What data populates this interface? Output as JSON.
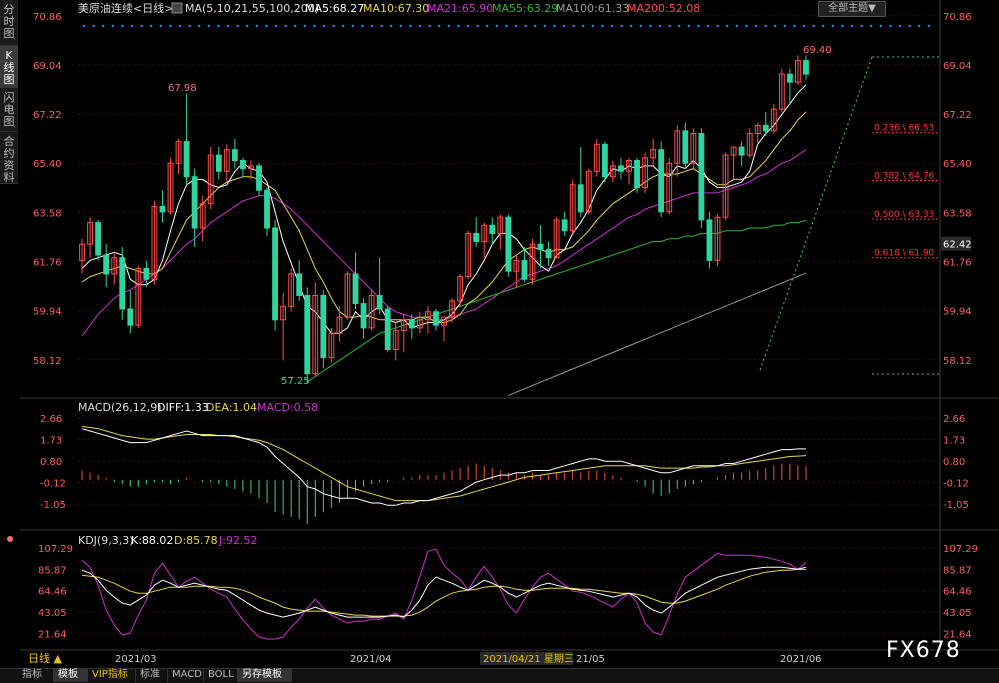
{
  "sidebar": {
    "tabs": [
      "分时图",
      "K线图",
      "闪电图",
      "合约资料"
    ],
    "active": 1
  },
  "header": {
    "symbol": "美原油连续<日线>",
    "ma_label": "MA(5,10,21,55,100,200)",
    "ma5": "MA5:68.27",
    "ma10": "MA10:67.30",
    "ma21": "MA21:65.90",
    "ma55": "MA55:63.29",
    "ma100": "MA100:61.33",
    "ma200": "MA200:52.08",
    "theme_button": "全部主题▼"
  },
  "colors": {
    "up": "#ff4d4d",
    "down": "#2fd4a0",
    "ma5": "#ffffff",
    "ma10": "#e6d84a",
    "ma21": "#d02fd0",
    "ma55": "#2eb82e",
    "ma100": "#9a9a9a",
    "fib": "#ff3333",
    "dotted": "#1e8fff",
    "grid": "#3a0a0a"
  },
  "main_axis": {
    "ticks": [
      "70.86",
      "69.04",
      "67.22",
      "65.40",
      "63.58",
      "61.76",
      "59.94",
      "58.12"
    ],
    "current_price": "62.42"
  },
  "annotations": {
    "high_label": "67.98",
    "low_label": "57.25",
    "recent_high_label": "69.40"
  },
  "fib_levels": [
    "0.236 \\ 66.53",
    "0.382 \\ 64.76",
    "0.500 \\ 63.33",
    "0.618 \\ 61.90"
  ],
  "macd": {
    "title": "MACD(26,12,9)",
    "diff": "DIFF:1.33",
    "dea": "DEA:1.04",
    "macd": "MACD:0.58",
    "ticks": [
      "2.66",
      "1.73",
      "0.80",
      "-0.12",
      "-1.05"
    ]
  },
  "kdj": {
    "title": "KDJ(9,3,3)",
    "k": "K:88.02",
    "d": "D:85.78",
    "j": "J:92.52",
    "ticks": [
      "107.29",
      "85.87",
      "64.46",
      "43.05",
      "21.64"
    ]
  },
  "time_axis": {
    "labels": [
      "2021/03",
      "2021/04",
      "2021/04/21 星期三",
      "21/05",
      "2021/06"
    ],
    "period": "日线 ▲"
  },
  "bottom_tabs": [
    "指标",
    "模板",
    "VIP指标",
    "标准",
    "MACD",
    "BOLL",
    "另存模板"
  ],
  "watermark": "FX678",
  "chart_data": {
    "type": "candlestick",
    "ylim": [
      57.0,
      71.0
    ],
    "candles": [
      [
        61.8,
        62.6,
        61.3,
        62.4
      ],
      [
        62.4,
        63.4,
        61.9,
        63.2
      ],
      [
        63.2,
        63.3,
        61.8,
        62.0
      ],
      [
        62.0,
        62.4,
        60.8,
        61.3
      ],
      [
        61.3,
        62.1,
        60.9,
        61.9
      ],
      [
        61.9,
        62.3,
        59.6,
        60.0
      ],
      [
        60.0,
        60.7,
        59.1,
        59.4
      ],
      [
        59.4,
        61.6,
        59.3,
        61.5
      ],
      [
        61.5,
        61.8,
        60.8,
        61.1
      ],
      [
        61.1,
        64.0,
        60.9,
        63.8
      ],
      [
        63.8,
        64.4,
        63.2,
        63.6
      ],
      [
        63.6,
        65.6,
        63.5,
        65.4
      ],
      [
        65.4,
        66.3,
        65.0,
        66.2
      ],
      [
        66.2,
        67.98,
        64.6,
        64.9
      ],
      [
        64.9,
        65.2,
        62.3,
        63.0
      ],
      [
        63.0,
        64.2,
        62.5,
        63.9
      ],
      [
        63.9,
        66.0,
        63.7,
        65.7
      ],
      [
        65.7,
        66.0,
        64.8,
        65.1
      ],
      [
        65.1,
        66.1,
        64.7,
        65.9
      ],
      [
        65.9,
        66.3,
        65.2,
        65.5
      ],
      [
        65.5,
        65.6,
        64.9,
        65.2
      ],
      [
        65.2,
        65.5,
        64.8,
        65.3
      ],
      [
        65.3,
        65.4,
        64.2,
        64.4
      ],
      [
        64.4,
        64.5,
        62.7,
        63.0
      ],
      [
        63.0,
        63.3,
        59.2,
        59.6
      ],
      [
        59.6,
        60.6,
        58.1,
        60.1
      ],
      [
        60.1,
        61.5,
        59.9,
        61.3
      ],
      [
        61.3,
        61.8,
        60.3,
        60.5
      ],
      [
        60.5,
        60.8,
        57.25,
        57.6
      ],
      [
        57.6,
        61.0,
        57.5,
        60.5
      ],
      [
        60.5,
        60.7,
        57.8,
        58.2
      ],
      [
        58.2,
        59.3,
        58.0,
        59.1
      ],
      [
        59.1,
        60.1,
        58.8,
        59.7
      ],
      [
        59.7,
        61.4,
        59.6,
        61.3
      ],
      [
        61.3,
        62.1,
        60.0,
        60.2
      ],
      [
        60.2,
        60.4,
        58.9,
        59.3
      ],
      [
        59.3,
        60.7,
        59.2,
        60.5
      ],
      [
        60.5,
        61.9,
        59.8,
        60.0
      ],
      [
        60.0,
        60.1,
        58.4,
        58.5
      ],
      [
        58.5,
        59.5,
        58.1,
        59.2
      ],
      [
        59.2,
        59.8,
        58.4,
        59.6
      ],
      [
        59.6,
        59.8,
        58.9,
        59.3
      ],
      [
        59.3,
        59.9,
        59.1,
        59.6
      ],
      [
        59.6,
        60.1,
        59.1,
        59.9
      ],
      [
        59.9,
        60.0,
        59.2,
        59.4
      ],
      [
        59.4,
        59.6,
        58.8,
        59.7
      ],
      [
        59.7,
        60.4,
        59.5,
        60.3
      ],
      [
        60.3,
        61.3,
        60.1,
        61.2
      ],
      [
        61.2,
        62.9,
        61.1,
        62.8
      ],
      [
        62.8,
        63.4,
        62.3,
        62.5
      ],
      [
        62.5,
        63.2,
        61.9,
        63.1
      ],
      [
        63.1,
        63.4,
        62.4,
        62.8
      ],
      [
        62.8,
        63.5,
        62.2,
        63.4
      ],
      [
        63.4,
        63.5,
        61.2,
        61.4
      ],
      [
        61.4,
        62.0,
        60.8,
        61.8
      ],
      [
        61.8,
        62.3,
        61.0,
        61.1
      ],
      [
        61.1,
        62.6,
        60.9,
        62.4
      ],
      [
        62.4,
        63.1,
        61.5,
        62.2
      ],
      [
        62.2,
        62.5,
        61.6,
        61.9
      ],
      [
        61.9,
        63.4,
        61.9,
        63.3
      ],
      [
        63.3,
        63.6,
        62.7,
        62.9
      ],
      [
        62.9,
        64.8,
        62.8,
        64.6
      ],
      [
        64.6,
        66.0,
        63.4,
        63.6
      ],
      [
        63.6,
        65.2,
        63.5,
        65.1
      ],
      [
        65.1,
        66.3,
        64.9,
        66.1
      ],
      [
        66.1,
        66.2,
        64.7,
        64.9
      ],
      [
        64.9,
        65.5,
        64.7,
        65.3
      ],
      [
        65.3,
        65.6,
        64.8,
        65.1
      ],
      [
        65.1,
        65.6,
        64.6,
        65.5
      ],
      [
        65.5,
        65.6,
        64.3,
        64.5
      ],
      [
        64.5,
        65.8,
        64.3,
        65.6
      ],
      [
        65.6,
        66.3,
        65.3,
        65.9
      ],
      [
        65.9,
        66.2,
        63.4,
        63.6
      ],
      [
        63.6,
        65.6,
        63.5,
        65.4
      ],
      [
        65.4,
        66.8,
        64.9,
        66.6
      ],
      [
        66.6,
        66.9,
        65.2,
        65.4
      ],
      [
        65.4,
        66.7,
        65.2,
        66.5
      ],
      [
        66.5,
        66.7,
        63.0,
        63.3
      ],
      [
        63.3,
        63.6,
        61.5,
        61.8
      ],
      [
        61.8,
        63.5,
        61.6,
        63.4
      ],
      [
        63.4,
        65.8,
        63.3,
        65.7
      ],
      [
        65.7,
        66.0,
        64.8,
        66.0
      ],
      [
        66.0,
        66.2,
        65.3,
        65.7
      ],
      [
        65.7,
        66.7,
        65.6,
        66.5
      ],
      [
        66.5,
        66.9,
        66.1,
        66.8
      ],
      [
        66.8,
        67.3,
        66.4,
        66.6
      ],
      [
        66.6,
        67.6,
        66.5,
        67.4
      ],
      [
        67.4,
        68.9,
        67.3,
        68.7
      ],
      [
        68.7,
        68.9,
        67.6,
        68.4
      ],
      [
        68.4,
        69.4,
        68.3,
        69.2
      ],
      [
        69.2,
        69.4,
        68.5,
        68.7
      ]
    ],
    "ma5_values": [
      61.5,
      61.8,
      61.9,
      62.0,
      62.1,
      62.0,
      61.1,
      60.9,
      60.9,
      61.1,
      61.8,
      62.9,
      63.9,
      64.6,
      64.8,
      64.8,
      64.6,
      64.5,
      64.6,
      65.1,
      65.4,
      65.2,
      65.1,
      64.7,
      63.6,
      62.5,
      61.7,
      60.9,
      60.1,
      59.9,
      59.5,
      59.1,
      59.1,
      59.3,
      59.9,
      59.6,
      59.9,
      60.1,
      59.6,
      59.5,
      59.6,
      59.3,
      59.4,
      59.5,
      59.5,
      59.6,
      59.8,
      60.2,
      60.9,
      61.3,
      61.8,
      62.4,
      62.8,
      62.8,
      62.6,
      62.2,
      61.9,
      61.6,
      61.4,
      62.0,
      62.2,
      62.8,
      63.2,
      63.7,
      64.4,
      64.8,
      65.2,
      65.1,
      65.3,
      65.2,
      65.3,
      65.3,
      65.0,
      64.9,
      65.3,
      65.2,
      65.5,
      65.2,
      64.7,
      64.5,
      64.5,
      64.6,
      64.7,
      65.1,
      66.1,
      66.5,
      66.8,
      67.2,
      67.6,
      68.0,
      68.3
    ],
    "ma10_values": [
      61.0,
      61.2,
      61.3,
      61.4,
      61.5,
      61.6,
      61.5,
      61.4,
      61.3,
      61.3,
      61.5,
      62.1,
      62.7,
      63.3,
      63.6,
      63.9,
      64.2,
      64.5,
      64.7,
      64.8,
      64.9,
      64.9,
      64.8,
      64.6,
      64.4,
      63.9,
      63.4,
      62.9,
      62.2,
      61.5,
      61.0,
      60.4,
      59.9,
      59.7,
      59.7,
      59.8,
      59.7,
      59.6,
      59.6,
      59.6,
      59.6,
      59.6,
      59.7,
      59.7,
      59.5,
      59.5,
      59.6,
      59.8,
      60.2,
      60.4,
      60.7,
      61.0,
      61.4,
      61.8,
      62.0,
      62.2,
      62.3,
      62.2,
      62.1,
      62.2,
      62.2,
      62.3,
      62.6,
      62.9,
      63.3,
      63.6,
      63.9,
      64.1,
      64.3,
      64.5,
      64.7,
      64.9,
      65.0,
      65.0,
      65.0,
      65.1,
      65.2,
      65.0,
      64.8,
      64.6,
      64.6,
      64.8,
      64.8,
      64.9,
      65.2,
      65.5,
      65.9,
      66.3,
      66.6,
      67.0,
      67.3
    ],
    "ma21_values": [
      59.0,
      59.4,
      59.8,
      60.1,
      60.4,
      60.6,
      60.7,
      60.9,
      61.1,
      61.3,
      61.5,
      61.8,
      62.1,
      62.4,
      62.6,
      62.9,
      63.2,
      63.4,
      63.6,
      63.8,
      64.0,
      64.1,
      64.2,
      64.2,
      64.1,
      63.9,
      63.7,
      63.4,
      63.1,
      62.8,
      62.5,
      62.2,
      61.9,
      61.6,
      61.3,
      61.0,
      60.7,
      60.4,
      60.1,
      59.9,
      59.8,
      59.7,
      59.7,
      59.6,
      59.6,
      59.6,
      59.7,
      59.8,
      59.9,
      60.0,
      60.2,
      60.4,
      60.6,
      60.8,
      61.0,
      61.2,
      61.3,
      61.4,
      61.5,
      61.6,
      61.8,
      62.0,
      62.2,
      62.4,
      62.6,
      62.8,
      63.0,
      63.2,
      63.4,
      63.5,
      63.7,
      63.8,
      63.9,
      64.0,
      64.1,
      64.2,
      64.3,
      64.3,
      64.3,
      64.3,
      64.4,
      64.5,
      64.6,
      64.7,
      64.9,
      65.0,
      65.2,
      65.4,
      65.5,
      65.7,
      65.9
    ],
    "ma55_values": [
      null,
      null,
      null,
      null,
      null,
      null,
      null,
      null,
      null,
      null,
      null,
      null,
      null,
      null,
      null,
      null,
      null,
      null,
      null,
      null,
      null,
      null,
      null,
      null,
      null,
      null,
      null,
      null,
      57.3,
      57.5,
      57.7,
      57.9,
      58.1,
      58.3,
      58.5,
      58.7,
      58.9,
      59.1,
      59.2,
      59.3,
      59.4,
      59.5,
      59.6,
      59.7,
      59.8,
      59.9,
      60.0,
      60.1,
      60.2,
      60.3,
      60.4,
      60.5,
      60.6,
      60.7,
      60.8,
      60.9,
      61.0,
      61.1,
      61.2,
      61.3,
      61.4,
      61.5,
      61.6,
      61.7,
      61.8,
      61.9,
      62.0,
      62.1,
      62.2,
      62.3,
      62.4,
      62.5,
      62.5,
      62.6,
      62.6,
      62.7,
      62.7,
      62.8,
      62.8,
      62.8,
      62.9,
      62.9,
      62.9,
      63.0,
      63.0,
      63.0,
      63.1,
      63.1,
      63.2,
      63.2,
      63.29
    ],
    "ma100_line": {
      "start_index": 53,
      "start_value": 56.8,
      "end_index": 90,
      "end_value": 61.33
    },
    "macd_hist": [
      0.4,
      0.3,
      0.2,
      0.1,
      -0.1,
      -0.2,
      -0.3,
      -0.3,
      -0.2,
      -0.1,
      -0.1,
      -0.2,
      -0.1,
      0.1,
      0.0,
      -0.1,
      -0.1,
      -0.2,
      -0.3,
      -0.4,
      -0.5,
      -0.6,
      -0.8,
      -1.0,
      -1.4,
      -1.5,
      -1.6,
      -1.7,
      -1.9,
      -1.6,
      -1.4,
      -1.2,
      -1.0,
      -0.8,
      -0.5,
      -0.3,
      -0.2,
      -0.1,
      -0.1,
      0.0,
      0.1,
      0.1,
      0.2,
      0.2,
      0.2,
      0.3,
      0.4,
      0.5,
      0.6,
      0.7,
      0.6,
      0.5,
      0.4,
      0.3,
      0.3,
      0.2,
      0.3,
      0.2,
      0.2,
      0.3,
      0.3,
      0.4,
      0.3,
      0.4,
      0.4,
      0.3,
      0.2,
      0.1,
      0.0,
      -0.1,
      -0.3,
      -0.6,
      -0.7,
      -0.6,
      -0.4,
      -0.3,
      -0.2,
      -0.1,
      0.0,
      0.1,
      0.2,
      0.3,
      0.3,
      0.4,
      0.4,
      0.5,
      0.6,
      0.7,
      0.7,
      0.6,
      0.58
    ],
    "macd_diff": [
      2.2,
      2.1,
      2.0,
      1.9,
      1.8,
      1.7,
      1.6,
      1.6,
      1.6,
      1.7,
      1.8,
      1.9,
      2.0,
      2.1,
      2.0,
      1.9,
      1.9,
      1.9,
      1.9,
      1.9,
      1.8,
      1.7,
      1.6,
      1.4,
      1.0,
      0.7,
      0.4,
      0.1,
      -0.3,
      -0.4,
      -0.6,
      -0.7,
      -0.8,
      -0.8,
      -0.8,
      -0.9,
      -1.0,
      -1.0,
      -1.1,
      -1.1,
      -1.0,
      -1.0,
      -0.9,
      -0.9,
      -0.8,
      -0.7,
      -0.6,
      -0.5,
      -0.3,
      -0.1,
      0.0,
      0.1,
      0.2,
      0.2,
      0.3,
      0.3,
      0.4,
      0.4,
      0.4,
      0.5,
      0.6,
      0.7,
      0.8,
      0.9,
      0.9,
      0.8,
      0.8,
      0.8,
      0.7,
      0.6,
      0.5,
      0.4,
      0.3,
      0.3,
      0.4,
      0.5,
      0.6,
      0.6,
      0.6,
      0.6,
      0.7,
      0.7,
      0.8,
      0.9,
      1.0,
      1.1,
      1.2,
      1.3,
      1.3,
      1.33,
      1.33
    ],
    "macd_dea": [
      2.3,
      2.25,
      2.2,
      2.1,
      2.0,
      1.9,
      1.85,
      1.8,
      1.75,
      1.75,
      1.8,
      1.85,
      1.9,
      1.95,
      1.95,
      1.95,
      1.95,
      1.9,
      1.9,
      1.85,
      1.8,
      1.75,
      1.7,
      1.6,
      1.45,
      1.3,
      1.1,
      0.9,
      0.7,
      0.5,
      0.3,
      0.1,
      -0.1,
      -0.3,
      -0.4,
      -0.5,
      -0.6,
      -0.7,
      -0.8,
      -0.9,
      -0.9,
      -0.9,
      -0.9,
      -0.9,
      -0.85,
      -0.8,
      -0.75,
      -0.7,
      -0.6,
      -0.5,
      -0.4,
      -0.3,
      -0.2,
      -0.1,
      0.0,
      0.1,
      0.15,
      0.2,
      0.25,
      0.3,
      0.35,
      0.4,
      0.45,
      0.5,
      0.55,
      0.6,
      0.6,
      0.6,
      0.6,
      0.6,
      0.6,
      0.55,
      0.5,
      0.5,
      0.5,
      0.5,
      0.5,
      0.55,
      0.55,
      0.6,
      0.6,
      0.65,
      0.7,
      0.75,
      0.8,
      0.85,
      0.9,
      0.95,
      1.0,
      1.02,
      1.04
    ],
    "kdj_k": [
      85,
      82,
      75,
      65,
      58,
      52,
      50,
      55,
      60,
      70,
      75,
      72,
      68,
      70,
      72,
      70,
      68,
      66,
      65,
      60,
      55,
      50,
      45,
      42,
      40,
      38,
      40,
      42,
      45,
      48,
      45,
      42,
      40,
      38,
      38,
      38,
      38,
      38,
      39,
      40,
      38,
      45,
      55,
      70,
      78,
      75,
      72,
      68,
      65,
      70,
      75,
      72,
      68,
      62,
      58,
      62,
      66,
      70,
      72,
      70,
      68,
      66,
      65,
      64,
      62,
      60,
      58,
      60,
      62,
      58,
      50,
      45,
      42,
      48,
      55,
      62,
      66,
      70,
      74,
      78,
      80,
      82,
      84,
      86,
      87,
      88,
      88,
      88,
      87,
      86,
      88
    ],
    "kdj_d": [
      80,
      79,
      78,
      75,
      72,
      68,
      64,
      62,
      62,
      64,
      66,
      68,
      68,
      68,
      69,
      69,
      69,
      68,
      68,
      67,
      65,
      62,
      58,
      55,
      52,
      48,
      46,
      45,
      44,
      44,
      44,
      43,
      42,
      41,
      40,
      40,
      39,
      39,
      39,
      39,
      39,
      40,
      43,
      48,
      54,
      58,
      62,
      64,
      65,
      66,
      68,
      69,
      69,
      68,
      66,
      65,
      65,
      66,
      67,
      67,
      67,
      67,
      66,
      66,
      65,
      64,
      63,
      62,
      62,
      61,
      59,
      56,
      53,
      52,
      52,
      54,
      57,
      60,
      63,
      66,
      70,
      73,
      76,
      79,
      81,
      83,
      84,
      85,
      85,
      86,
      85.78
    ],
    "kdj_j": [
      95,
      88,
      70,
      45,
      30,
      20,
      22,
      40,
      55,
      82,
      92,
      80,
      68,
      74,
      78,
      72,
      66,
      62,
      58,
      46,
      35,
      26,
      18,
      16,
      16,
      18,
      28,
      36,
      47,
      56,
      47,
      40,
      36,
      32,
      34,
      34,
      36,
      36,
      39,
      42,
      36,
      55,
      79,
      104,
      106,
      90,
      82,
      76,
      65,
      78,
      89,
      78,
      66,
      50,
      42,
      56,
      68,
      78,
      82,
      76,
      70,
      64,
      63,
      60,
      56,
      52,
      48,
      56,
      62,
      52,
      32,
      23,
      20,
      40,
      61,
      78,
      84,
      90,
      96,
      102,
      100,
      100,
      100,
      100,
      99,
      98,
      96,
      94,
      91,
      86,
      92.52
    ]
  }
}
